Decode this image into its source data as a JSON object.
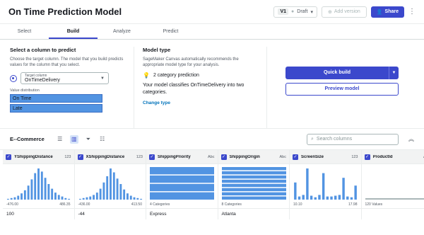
{
  "header": {
    "title": "On Time Prediction Model",
    "version": "V1",
    "status": "Draft",
    "add_version": "Add version",
    "share": "Share"
  },
  "tabs": [
    {
      "label": "Select"
    },
    {
      "label": "Build"
    },
    {
      "label": "Analyze"
    },
    {
      "label": "Predict"
    }
  ],
  "target": {
    "heading": "Select a column to predict",
    "description": "Choose the target column. The model that you build predicts values for the column that you select.",
    "field_label": "Target column",
    "value": "OnTimeDelivery",
    "distribution_label": "Value distribution",
    "distribution": [
      "On Time",
      "Late"
    ]
  },
  "model": {
    "heading": "Model type",
    "description": "SageMaker Canvas automatically recommends the appropriate model type for your analysis.",
    "prediction": "2 category prediction",
    "explanation": "Your model classifies OnTimeDelivery into two categories.",
    "change_link": "Change type"
  },
  "actions": {
    "quick_build": "Quick build",
    "preview": "Preview model"
  },
  "dataset": {
    "name": "E--Commerce",
    "search_placeholder": "Search columns"
  },
  "columns": [
    {
      "name": "YShippingDistance",
      "type": "123",
      "cap_left": "-476.00",
      "cap_right": "486.35",
      "row": "100",
      "kind": "hist",
      "values": [
        1,
        2,
        3,
        5,
        8,
        12,
        18,
        26,
        34,
        40,
        36,
        28,
        20,
        14,
        9,
        6,
        4,
        2,
        1
      ]
    },
    {
      "name": "XShippingDistance",
      "type": "123",
      "cap_left": "-436.00",
      "cap_right": "413.50",
      "row": "-44",
      "kind": "hist",
      "values": [
        1,
        2,
        3,
        4,
        6,
        9,
        14,
        22,
        30,
        40,
        35,
        27,
        20,
        13,
        8,
        5,
        3,
        2,
        1
      ]
    },
    {
      "name": "ShippingPriority",
      "type": "Abc",
      "cap_left": "4 Categories",
      "cap_right": "",
      "row": "Express",
      "kind": "cat",
      "values": [
        4
      ]
    },
    {
      "name": "ShippingOrigin",
      "type": "Abc",
      "cap_left": "8 Categories",
      "cap_right": "",
      "row": "Atlanta",
      "kind": "cat",
      "values": [
        8
      ]
    },
    {
      "name": "ScreenSize",
      "type": "123",
      "cap_left": "10.10",
      "cap_right": "17.98",
      "row": "",
      "kind": "hist",
      "values": [
        22,
        4,
        6,
        40,
        5,
        3,
        6,
        34,
        4,
        4,
        5,
        6,
        28,
        4,
        3,
        18
      ]
    },
    {
      "name": "ProductId",
      "type": "Abc",
      "cap_left": "120 Values",
      "cap_right": "",
      "row": "",
      "kind": "flat",
      "values": [
        1
      ]
    }
  ],
  "colors": {
    "accent": "#3b48cc",
    "bar": "#5294e2"
  }
}
